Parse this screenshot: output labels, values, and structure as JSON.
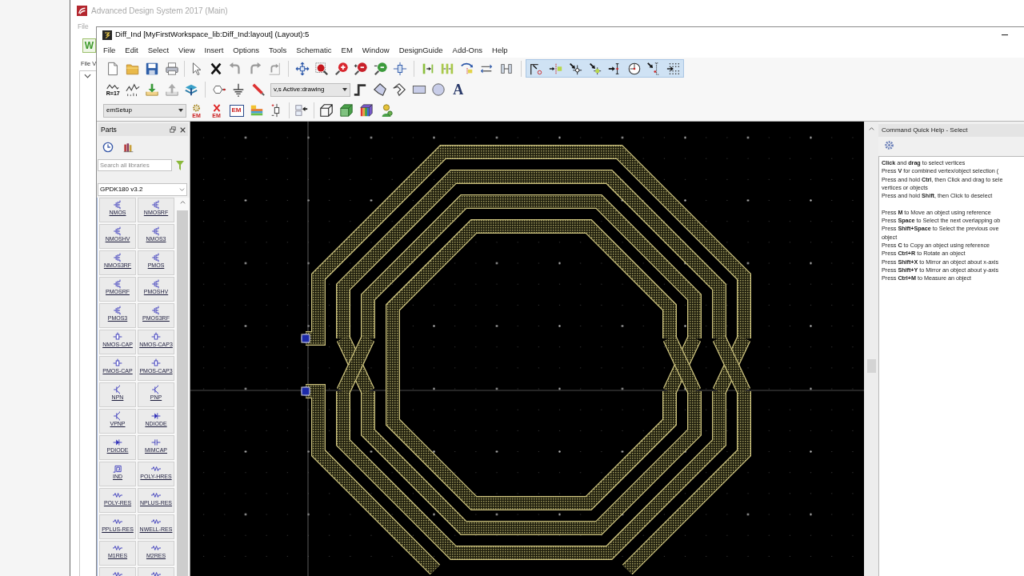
{
  "main_window": {
    "title": "Advanced Design System 2017 (Main)",
    "menu_item": "File",
    "workspace_button": "W",
    "tab": "File V"
  },
  "layout_window": {
    "title": "Diff_Ind [MyFirstWorkspace_lib:Diff_Ind:layout] (Layout):5",
    "menu": [
      "File",
      "Edit",
      "Select",
      "View",
      "Insert",
      "Options",
      "Tools",
      "Schematic",
      "EM",
      "Window",
      "DesignGuide",
      "Add-Ons",
      "Help"
    ],
    "toolbar_2": {
      "resistance_label": "R=17",
      "layer_dropdown": "v,s Active:drawing",
      "text_tool": "A"
    },
    "toolbar_3": {
      "setup_dropdown": "emSetup",
      "em_buttons": [
        {
          "kind": "gear",
          "label": "EM"
        },
        {
          "kind": "cancel",
          "label": "EM"
        },
        {
          "kind": "boxed",
          "label": "EM"
        }
      ]
    }
  },
  "parts_panel": {
    "title": "Parts",
    "search": {
      "placeholder": "Search all libraries"
    },
    "library": "GPDK180 v3.2",
    "parts": [
      {
        "kind": "mos",
        "label": "NMOS"
      },
      {
        "kind": "mos",
        "label": "NMOSRF"
      },
      {
        "kind": "mos",
        "label": "NMOSHV"
      },
      {
        "kind": "mos",
        "label": "NMOS3"
      },
      {
        "kind": "mos",
        "label": "NMOS3RF"
      },
      {
        "kind": "mos",
        "label": "PMOS"
      },
      {
        "kind": "mos",
        "label": "PMOSRF"
      },
      {
        "kind": "mos",
        "label": "PMOSHV"
      },
      {
        "kind": "mos",
        "label": "PMOS3"
      },
      {
        "kind": "mos",
        "label": "PMOS3RF"
      },
      {
        "kind": "moscap",
        "label": "NMOS-CAP"
      },
      {
        "kind": "moscap",
        "label": "NMOS-CAP3"
      },
      {
        "kind": "moscap",
        "label": "PMOS-CAP"
      },
      {
        "kind": "moscap",
        "label": "PMOS-CAP3"
      },
      {
        "kind": "bjt",
        "label": "NPN"
      },
      {
        "kind": "bjt",
        "label": "PNP"
      },
      {
        "kind": "bjt",
        "label": "VPNP"
      },
      {
        "kind": "diode",
        "label": "NDIODE"
      },
      {
        "kind": "diode",
        "label": "PDIODE"
      },
      {
        "kind": "cap",
        "label": "MIMCAP"
      },
      {
        "kind": "ind",
        "label": "IND"
      },
      {
        "kind": "res",
        "label": "POLY-HRES"
      },
      {
        "kind": "res",
        "label": "POLY-RES"
      },
      {
        "kind": "res",
        "label": "NPLUS-RES"
      },
      {
        "kind": "res",
        "label": "PPLUS-RES"
      },
      {
        "kind": "res",
        "label": "NWELL-RES"
      },
      {
        "kind": "res",
        "label": "M1RES"
      },
      {
        "kind": "res",
        "label": "M2RES"
      },
      {
        "kind": "res"
      },
      {
        "kind": "res"
      }
    ]
  },
  "quick_help": {
    "title": "Command Quick Help - Select",
    "paragraphs": [
      [
        "**Click** and **drag** to select vertices",
        "Press **V** for combined vertex/object selection (",
        "Press and hold **Ctrl**, then Click and drag to sele",
        "vertices or objects",
        "Press and hold **Shift**, then Click to deselect"
      ],
      [
        "Press **M** to Move an object using reference",
        "Press **Space** to Select the next overlapping ob",
        "Press **Shift+Space** to Select the previous ove",
        "object",
        "Press **C** to Copy an object using reference",
        "Press **Ctrl+R** to Rotate an object",
        "Press **Shift+X** to Mirror an object about x-axis",
        "Press **Shift+Y** to Mirror an object about y-axis",
        "Press **Ctrl+M** to Measure an object"
      ]
    ]
  }
}
